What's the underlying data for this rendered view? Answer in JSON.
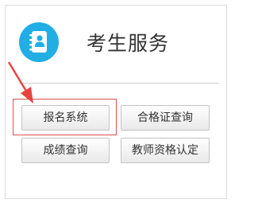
{
  "header": {
    "title": "考生服务",
    "icon": "address-book-icon",
    "icon_color": "#20aee5"
  },
  "buttons": {
    "registration": "报名系统",
    "certificate_query": "合格证查询",
    "score_query": "成绩查询",
    "teacher_qualification": "教师资格认定"
  },
  "annotation": {
    "highlight_color": "#d9534f",
    "arrow_color": "#e8443f"
  }
}
